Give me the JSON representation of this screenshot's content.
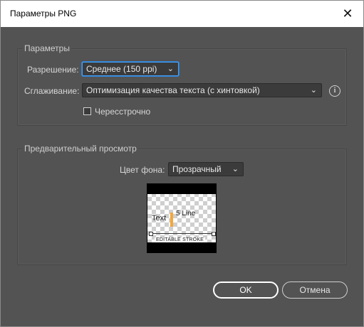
{
  "window": {
    "title": "Параметры PNG"
  },
  "params": {
    "legend": "Параметры",
    "resolution_label": "Разрешение:",
    "resolution_value": "Среднее (150 ppi)",
    "antialias_label": "Сглаживание:",
    "antialias_value": "Оптимизация качества текста (с хинтовкой)",
    "interlaced_label": "Чересстрочно",
    "interlaced_checked": false
  },
  "preview": {
    "legend": "Предварительный просмотр",
    "bg_label": "Цвет фона:",
    "bg_value": "Прозрачный",
    "thumb_text": "Text",
    "thumb_line": "5 Line",
    "thumb_stroke": "EDITABLE STROKE"
  },
  "buttons": {
    "ok": "OK",
    "cancel": "Отмена"
  },
  "colors": {
    "focus": "#46a0f5",
    "accent_bar": "#f4a73a",
    "dialog_bg": "#535353"
  },
  "icons": {
    "close": "close-icon",
    "info": "info-icon",
    "chevron": "chevron-down-icon"
  }
}
